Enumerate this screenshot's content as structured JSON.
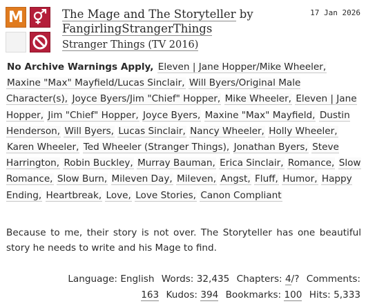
{
  "work": {
    "title": "The Mage and The Storyteller",
    "by_label": "by",
    "author": "FangirlingStrangerThings",
    "fandom": "Stranger Things (TV 2016)",
    "date": "17 Jan 2026",
    "symbols": {
      "rating": "M",
      "category": "♂♀",
      "warning_icon": "no-entry-icon",
      "complete_icon": "blank-square-icon"
    }
  },
  "tags": {
    "warning": "No Archive Warnings Apply,",
    "items": [
      "Eleven | Jane Hopper/Mike Wheeler,",
      "Maxine \"Max\" Mayfield/Lucas Sinclair,",
      "Will Byers/Original Male Character(s),",
      "Joyce Byers/Jim \"Chief\" Hopper,",
      "Mike Wheeler,",
      "Eleven | Jane Hopper,",
      "Jim \"Chief\" Hopper,",
      "Joyce Byers,",
      "Maxine \"Max\" Mayfield,",
      "Dustin Henderson,",
      "Will Byers,",
      "Lucas Sinclair,",
      "Nancy Wheeler,",
      "Holly Wheeler,",
      "Karen Wheeler,",
      "Ted Wheeler (Stranger Things),",
      "Jonathan Byers,",
      "Steve Harrington,",
      "Robin Buckley,",
      "Murray Bauman,",
      "Erica Sinclair,",
      "Romance,",
      "Slow Romance,",
      "Slow Burn,",
      "Mileven Day,",
      "Mileven,",
      "Angst,",
      "Fluff,",
      "Humor,",
      "Happy Ending,",
      "Heartbreak,",
      "Love,",
      "Love Stories,",
      "Canon Compliant"
    ]
  },
  "summary": "Because to me, their story is not over. The Storyteller has one beautiful story he needs to write and his Mage to find.",
  "stats": {
    "language_label": "Language:",
    "language": "English",
    "words_label": "Words:",
    "words": "32,435",
    "chapters_label": "Chapters:",
    "chapters_current": "4",
    "chapters_total": "/?",
    "comments_label": "Comments:",
    "comments": "163",
    "kudos_label": "Kudos:",
    "kudos": "394",
    "bookmarks_label": "Bookmarks:",
    "bookmarks": "100",
    "hits_label": "Hits:",
    "hits": "5,333"
  },
  "colors": {
    "rating_orange": "#e07b1f",
    "category_red": "#b41f3a",
    "text": "#2a2a2a"
  }
}
